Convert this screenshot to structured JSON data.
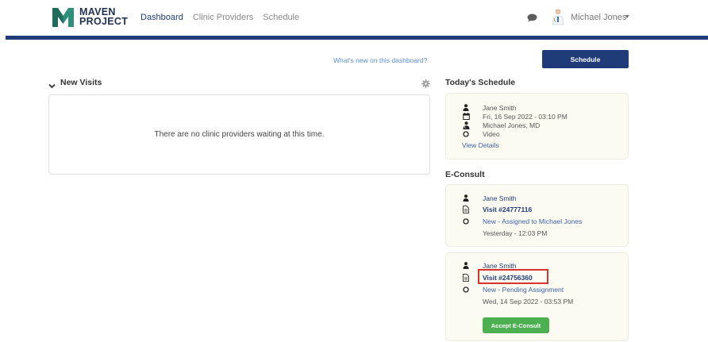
{
  "app": {
    "logo_line1": "MAVEN",
    "logo_line2": "PROJECT",
    "brand_color": "#1f3b78",
    "nav": [
      {
        "label": "Dashboard",
        "active": true
      },
      {
        "label": "Clinic Providers",
        "active": false
      },
      {
        "label": "Schedule",
        "active": false
      }
    ],
    "user": {
      "name": "Michael Jones"
    }
  },
  "toolbar": {
    "whats_new": "What's new on this dashboard?",
    "schedule_button": "Schedule"
  },
  "new_visits": {
    "title": "New Visits",
    "empty_message": "There are no clinic providers waiting at this time."
  },
  "todays_schedule": {
    "title": "Today's Schedule",
    "appointment": {
      "patient": "Jane Smith",
      "datetime": "Fri, 16 Sep 2022 - 03:10 PM",
      "provider": "Michael Jones, MD",
      "type": "Video",
      "view_details": "View Details"
    }
  },
  "econsult": {
    "title": "E-Consult",
    "items": [
      {
        "patient": "Jane Smith",
        "visit": "Visit #24777116",
        "status": "New - Assigned to Michael Jones",
        "time": "Yesterday - 12:03 PM"
      },
      {
        "patient": "Jane Smith",
        "visit": "Visit #24756360",
        "status": "New - Pending Assignment",
        "time": "Wed, 14 Sep 2022 - 03:53 PM",
        "accept_button": "Accept E-Consult"
      }
    ]
  },
  "colors": {
    "accent": "#1f3b78",
    "card_bg": "#fbfbf2",
    "highlight": "#d9332c",
    "accept": "#4cb050",
    "link": "#5b8fd1"
  }
}
